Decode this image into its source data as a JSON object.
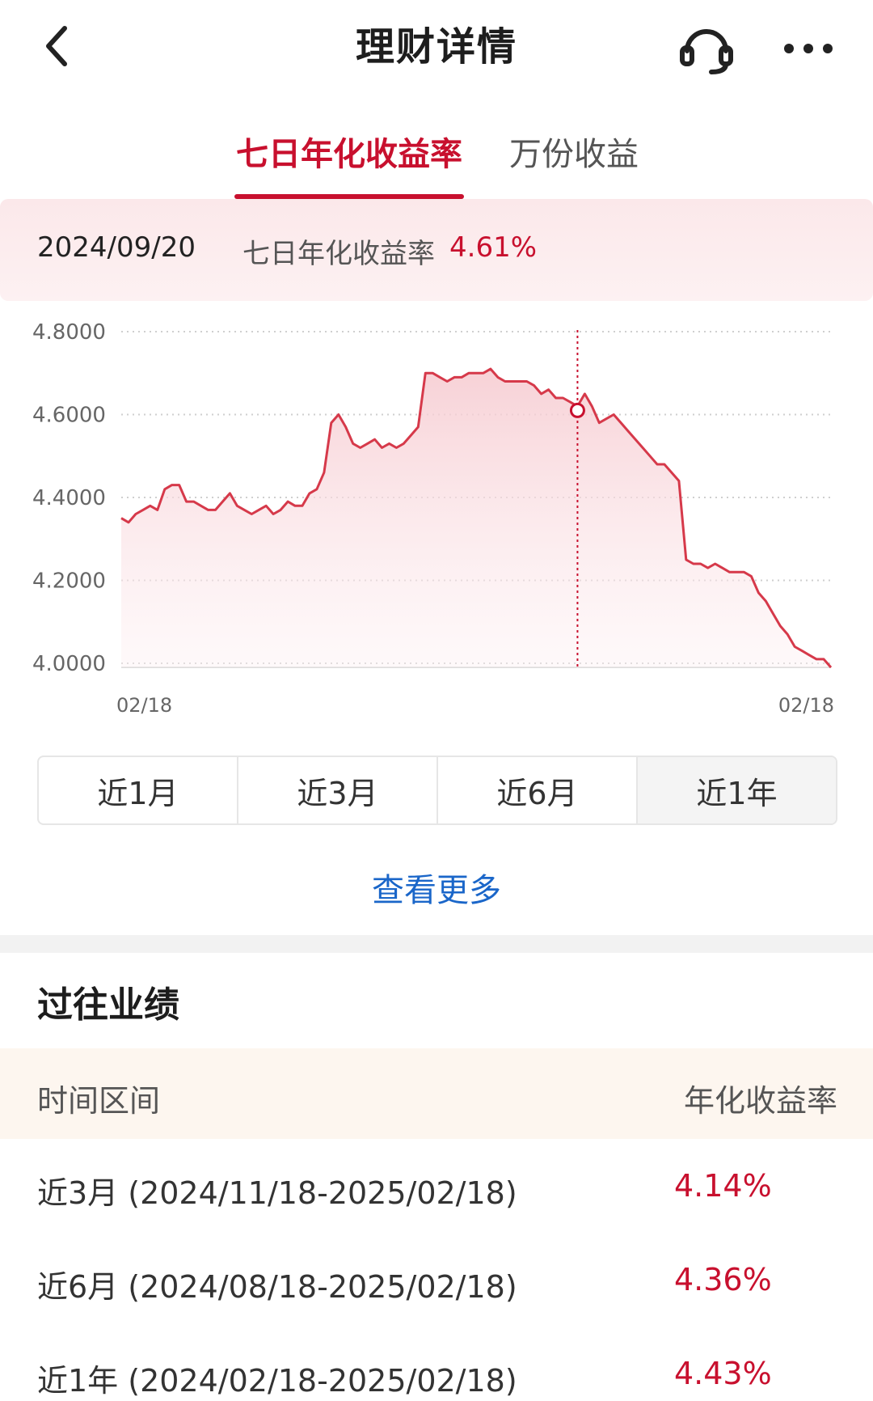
{
  "nav": {
    "title": "理财详情",
    "back_icon": "chevron-left-icon",
    "service_icon": "headset-icon",
    "more_icon": "more-dots-icon"
  },
  "tabs": [
    {
      "label": "七日年化收益率",
      "active": true
    },
    {
      "label": "万份收益",
      "active": false
    }
  ],
  "info": {
    "date": "2024/09/20",
    "label": "七日年化收益率",
    "value": "4.61%"
  },
  "colors": {
    "accent": "#c8102e",
    "link": "#1a66c9"
  },
  "chart_data": {
    "type": "area",
    "series_color": "#d6394a",
    "ylim": [
      4.0,
      4.8
    ],
    "y_ticks": [
      "4.8000",
      "4.6000",
      "4.4000",
      "4.2000",
      "4.0000"
    ],
    "x_tick_labels": [
      "02/18",
      "02/18"
    ],
    "grid": true,
    "highlight": {
      "date": "2024/09/20",
      "value": 4.61
    },
    "values": [
      4.35,
      4.34,
      4.36,
      4.37,
      4.38,
      4.37,
      4.42,
      4.43,
      4.43,
      4.39,
      4.39,
      4.38,
      4.37,
      4.37,
      4.39,
      4.41,
      4.38,
      4.37,
      4.36,
      4.37,
      4.38,
      4.36,
      4.37,
      4.39,
      4.38,
      4.38,
      4.41,
      4.42,
      4.46,
      4.58,
      4.6,
      4.57,
      4.53,
      4.52,
      4.53,
      4.54,
      4.52,
      4.53,
      4.52,
      4.53,
      4.55,
      4.57,
      4.7,
      4.7,
      4.69,
      4.68,
      4.69,
      4.69,
      4.7,
      4.7,
      4.7,
      4.71,
      4.69,
      4.68,
      4.68,
      4.68,
      4.68,
      4.67,
      4.65,
      4.66,
      4.64,
      4.64,
      4.63,
      4.62,
      4.65,
      4.62,
      4.58,
      4.59,
      4.6,
      4.58,
      4.56,
      4.54,
      4.52,
      4.5,
      4.48,
      4.48,
      4.46,
      4.44,
      4.25,
      4.24,
      4.24,
      4.23,
      4.24,
      4.23,
      4.22,
      4.22,
      4.22,
      4.21,
      4.17,
      4.15,
      4.12,
      4.09,
      4.07,
      4.04,
      4.03,
      4.02,
      4.01,
      4.01,
      3.99
    ]
  },
  "range_selector": {
    "options": [
      "近1月",
      "近3月",
      "近6月",
      "近1年"
    ],
    "selected": "近1年"
  },
  "more_link": "查看更多",
  "performance": {
    "title": "过往业绩",
    "header_period": "时间区间",
    "header_rate": "年化收益率",
    "rows": [
      {
        "period": "近3月 (2024/11/18-2025/02/18)",
        "rate": "4.14%"
      },
      {
        "period": "近6月 (2024/08/18-2025/02/18)",
        "rate": "4.36%"
      },
      {
        "period": "近1年 (2024/02/18-2025/02/18)",
        "rate": "4.43%"
      }
    ]
  }
}
